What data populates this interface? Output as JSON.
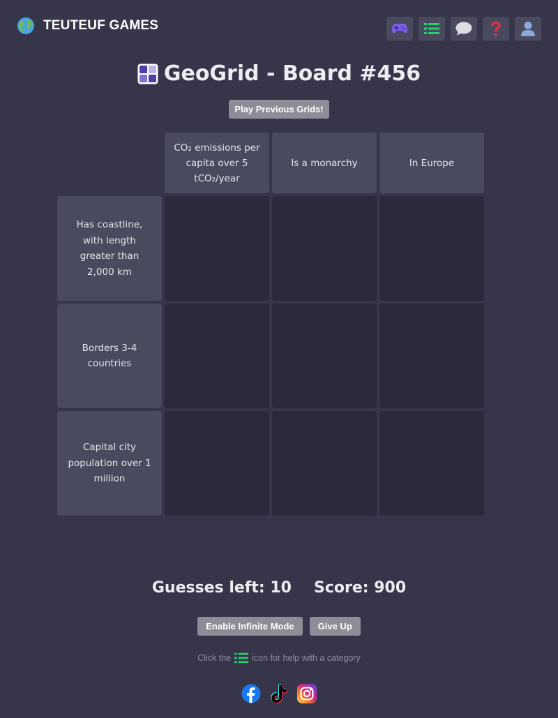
{
  "header": {
    "brand_name": "TEUTEUF GAMES",
    "logo_icon": "globe-icon",
    "nav": [
      {
        "icon": "gamepad-icon",
        "color": "#7a5ce8"
      },
      {
        "icon": "list-icon",
        "color": "#2ecc71"
      },
      {
        "icon": "chat-icon",
        "color": "#dcdce3"
      },
      {
        "icon": "question-icon",
        "color": "#d9344a"
      },
      {
        "icon": "user-icon",
        "color": "#8ba8d8"
      }
    ]
  },
  "title": {
    "text": "GeoGrid - Board #456",
    "logo_icon": "geogrid-logo-icon"
  },
  "prev_button": "Play Previous Grids!",
  "grid": {
    "columns": [
      "CO₂ emissions per capita over 5 tCO₂/year",
      "Is a monarchy",
      "In Europe"
    ],
    "rows": [
      "Has coastline, with length greater than 2,000 km",
      "Borders 3-4 countries",
      "Capital city population over 1 million"
    ]
  },
  "stats": {
    "guesses": "Guesses left: 10",
    "score": "Score: 900"
  },
  "buttons": {
    "infinite": "Enable Infinite Mode",
    "give_up": "Give Up"
  },
  "hint": {
    "before": "Click the",
    "after": "icon for help with a category"
  },
  "socials": [
    "facebook-icon",
    "tiktok-icon",
    "instagram-icon"
  ],
  "colors": {
    "background": "#363549",
    "header_cell": "#4a4a5e",
    "empty_cell": "#2a2a3b",
    "button": "#8d8c97",
    "accent_green": "#2ecc71"
  }
}
